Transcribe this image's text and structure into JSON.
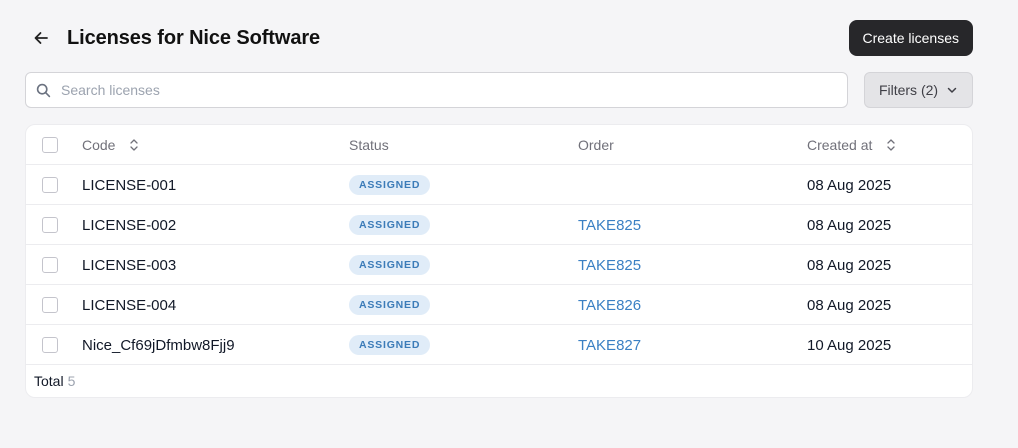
{
  "header": {
    "title": "Licenses for Nice Software",
    "back_icon": "arrow-left-icon",
    "create_label": "Create licenses"
  },
  "search": {
    "placeholder": "Search licenses",
    "value": "",
    "icon": "search-icon"
  },
  "filters": {
    "label": "Filters (2)",
    "icon": "chevron-down-icon"
  },
  "table": {
    "columns": {
      "code": "Code",
      "status": "Status",
      "order": "Order",
      "created_at": "Created at"
    },
    "rows": [
      {
        "code": "LICENSE-001",
        "status": "ASSIGNED",
        "order": "",
        "created_at": "08 Aug 2025"
      },
      {
        "code": "LICENSE-002",
        "status": "ASSIGNED",
        "order": "TAKE825",
        "created_at": "08 Aug 2025"
      },
      {
        "code": "LICENSE-003",
        "status": "ASSIGNED",
        "order": "TAKE825",
        "created_at": "08 Aug 2025"
      },
      {
        "code": "LICENSE-004",
        "status": "ASSIGNED",
        "order": "TAKE826",
        "created_at": "08 Aug 2025"
      },
      {
        "code": "Nice_Cf69jDfmbw8Fjj9",
        "status": "ASSIGNED",
        "order": "TAKE827",
        "created_at": "10 Aug 2025"
      }
    ],
    "footer": {
      "total_label": "Total",
      "total_count": "5"
    }
  },
  "colors": {
    "primary_button": "#27272a",
    "badge_bg": "#e0ecf8",
    "badge_text": "#3b7bb8",
    "link": "#3a80c4"
  }
}
